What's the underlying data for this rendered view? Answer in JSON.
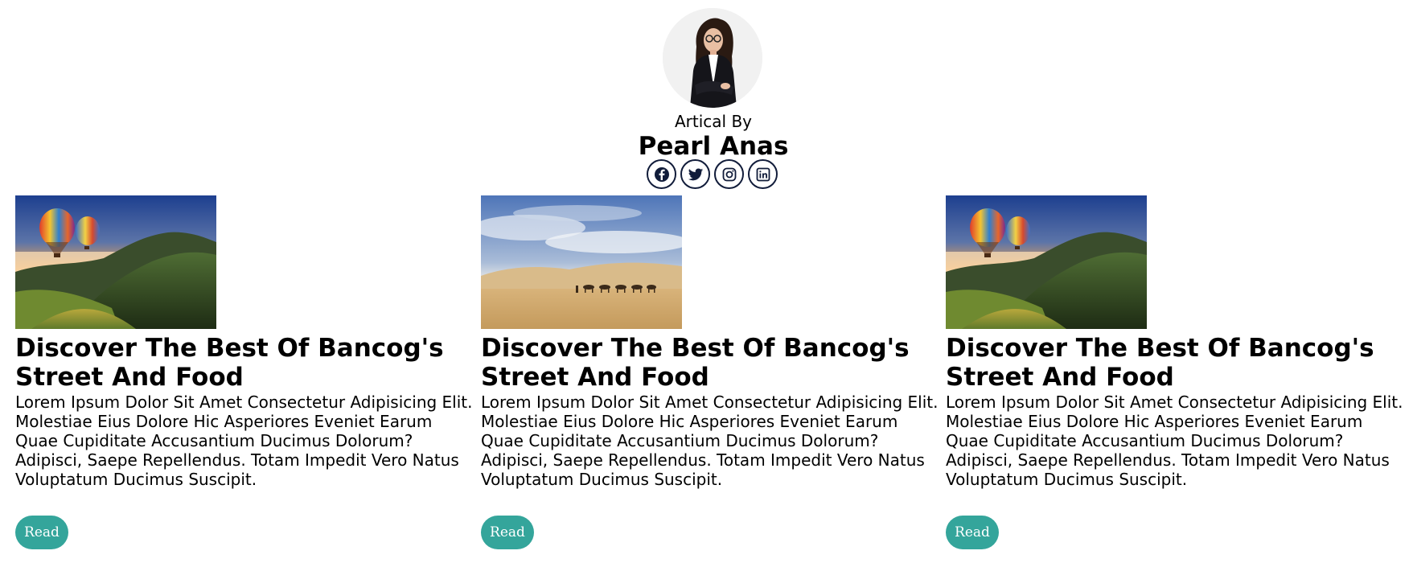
{
  "author": {
    "byline": "Artical By",
    "name": "Pearl Anas"
  },
  "socials": [
    {
      "icon": "facebook-icon"
    },
    {
      "icon": "twitter-icon"
    },
    {
      "icon": "instagram-icon"
    },
    {
      "icon": "linkedin-icon"
    }
  ],
  "articles": [
    {
      "image": "hot-air-balloons-mountain-image",
      "title": "Discover The Best Of Bancog's Street And Food",
      "body": [
        "Lorem Ipsum Dolor Sit Amet Consectetur Adipisicing Elit.",
        "Molestiae Eius Dolore Hic Asperiores Eveniet Earum",
        "Quae Cupiditate Accusantium Ducimus Dolorum?",
        "Adipisci, Saepe Repellendus. Totam Impedit Vero Natus",
        "Voluptatum Ducimus Suscipit."
      ],
      "button": "Read"
    },
    {
      "image": "desert-camel-caravan-image",
      "title": "Discover The Best Of Bancog's Street And Food",
      "body": [
        "Lorem Ipsum Dolor Sit Amet Consectetur Adipisicing Elit.",
        "Molestiae Eius Dolore Hic Asperiores Eveniet Earum",
        "Quae Cupiditate Accusantium Ducimus Dolorum?",
        "Adipisci, Saepe Repellendus. Totam Impedit Vero Natus",
        "Voluptatum Ducimus Suscipit."
      ],
      "button": "Read"
    },
    {
      "image": "hot-air-balloons-mountain-image",
      "title": "Discover The Best Of Bancog's Street And Food",
      "body": [
        "Lorem Ipsum Dolor Sit Amet Consectetur Adipisicing Elit.",
        "Molestiae Eius Dolore Hic Asperiores Eveniet Earum",
        "Quae Cupiditate Accusantium Ducimus Dolorum?",
        "Adipisci, Saepe Repellendus. Totam Impedit Vero Natus",
        "Voluptatum Ducimus Suscipit."
      ],
      "button": "Read"
    }
  ],
  "colors": {
    "accent": "#34a59b",
    "icon_border": "#111c3a"
  }
}
